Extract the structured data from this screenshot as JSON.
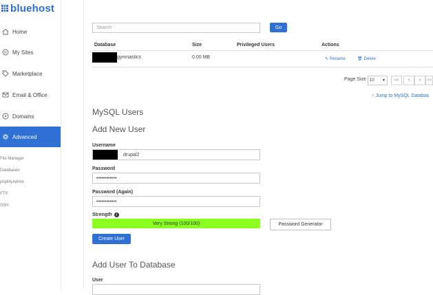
{
  "brand": {
    "name": "bluehost",
    "color": "#2a6fdb"
  },
  "sidebar": {
    "items": [
      {
        "label": "Home",
        "icon": "home-icon"
      },
      {
        "label": "My Sites",
        "icon": "wordpress-icon"
      },
      {
        "label": "Marketplace",
        "icon": "tag-icon"
      },
      {
        "label": "Email & Office",
        "icon": "envelope-icon"
      },
      {
        "label": "Domains",
        "icon": "compass-icon"
      },
      {
        "label": "Advanced",
        "icon": "gear-icon",
        "active": true
      }
    ],
    "subitems": [
      "File Manager",
      "Databases",
      "phpMyAdmin",
      "FTP",
      "SSH"
    ]
  },
  "search": {
    "placeholder": "Search",
    "go_label": "Go"
  },
  "db_table": {
    "headers": [
      "Database",
      "Size",
      "Privileged Users",
      "Actions"
    ],
    "rows": [
      {
        "database": "gymnastics",
        "size": "0.00 MB",
        "rename": "Rename",
        "delete": "Delete"
      }
    ]
  },
  "pagination": {
    "label": "Page Size",
    "value": "10",
    "buttons": [
      "<<",
      "<",
      ">",
      ">>"
    ]
  },
  "jump_link": "Jump to MySQL Databas",
  "mysql_users": {
    "title": "MySQL Users",
    "add_new_user": "Add New User",
    "username_label": "Username",
    "username_value": "drupal2",
    "password_label": "Password",
    "password_value": "••••••••••••",
    "password_again_label": "Password (Again)",
    "password_again_value": "••••••••••••",
    "strength_label": "Strength",
    "strength_value": "Very Strong (100/100)",
    "password_generator": "Password Generator",
    "create_user": "Create User"
  },
  "add_user_to_db": {
    "title": "Add User To Database",
    "user_label": "User"
  },
  "colors": {
    "accent": "#2e70d4",
    "strength": "#8aff1f"
  }
}
